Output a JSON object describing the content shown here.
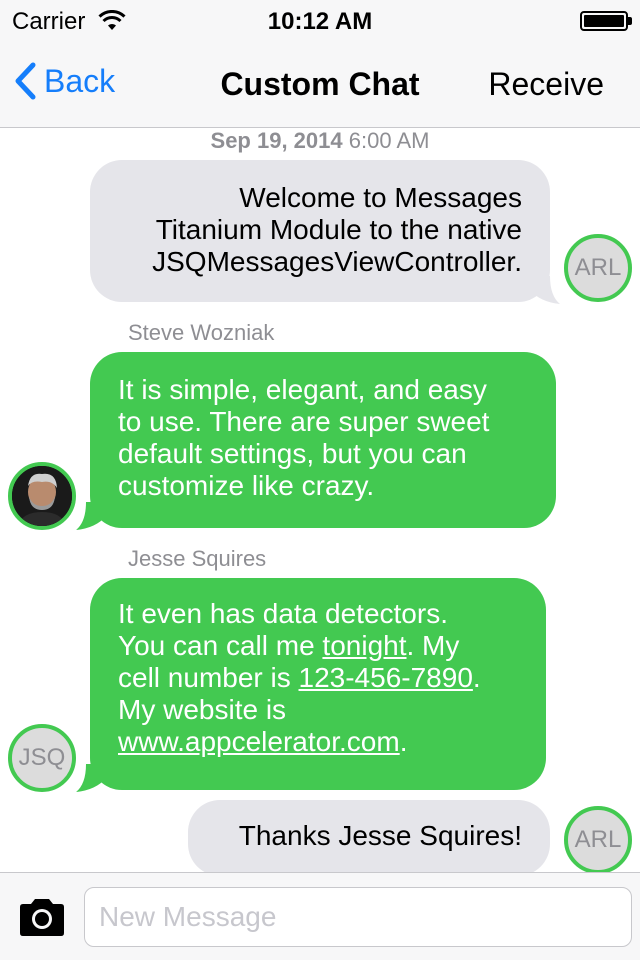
{
  "status_bar": {
    "carrier": "Carrier",
    "time": "10:12 AM",
    "icons": [
      "wifi-icon",
      "battery-icon"
    ]
  },
  "nav": {
    "back_label": "Back",
    "title": "Custom Chat",
    "receive_label": "Receive"
  },
  "chat": {
    "timestamp_date": "Sep 19, 2014",
    "timestamp_time": "6:00 AM",
    "messages": [
      {
        "side": "incoming",
        "lines": [
          "Welcome to Messages",
          "Titanium Module to the native",
          "JSQMessagesViewController."
        ],
        "avatar_initials": "ARL"
      },
      {
        "side": "outgoing",
        "sender": "Steve Wozniak",
        "lines": [
          "It is simple, elegant, and easy",
          "to use. There are super sweet",
          "default settings, but you can",
          "customize like crazy."
        ],
        "avatar": "photo"
      },
      {
        "side": "outgoing",
        "sender": "Jesse Squires",
        "line1": "It even has data detectors.",
        "line2_a": "You can call me ",
        "line2_link": "tonight",
        "line2_b": ". My",
        "line3_a": "cell number is ",
        "line3_link": "123-456-7890",
        "line3_b": ".",
        "line4": "My website is",
        "line5_link": "www.appcelerator.com",
        "line5_b": ".",
        "avatar_initials": "JSQ"
      },
      {
        "side": "incoming",
        "lines": [
          "Thanks Jesse Squires!"
        ],
        "avatar_initials": "ARL"
      }
    ]
  },
  "input": {
    "placeholder": "New Message"
  },
  "colors": {
    "accent": "#157efb",
    "outgoing_bubble": "#43c951",
    "incoming_bubble": "#e5e5ea",
    "meta_text": "#8e8e93"
  }
}
